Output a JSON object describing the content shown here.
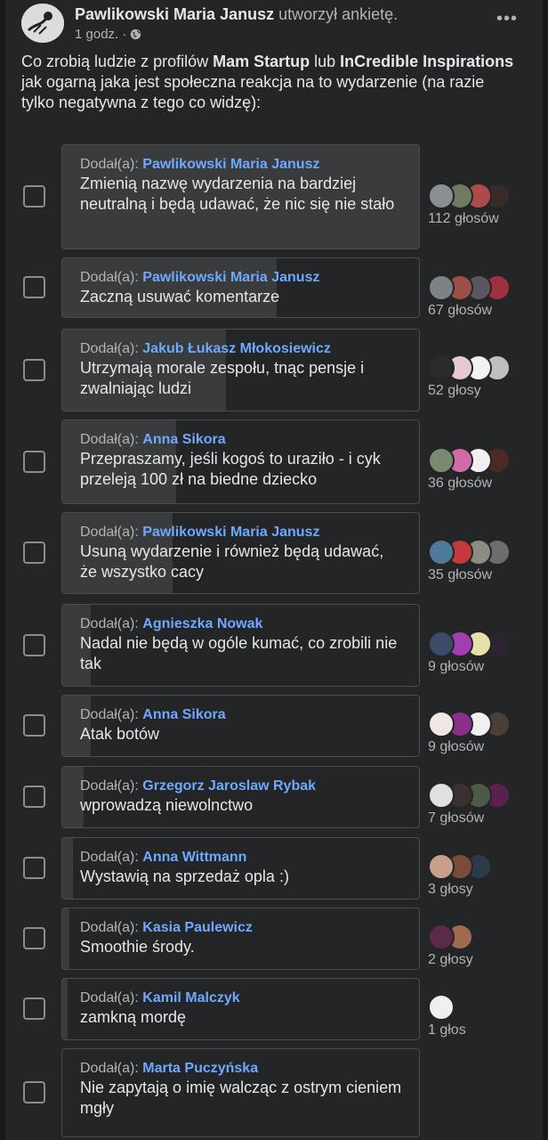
{
  "post": {
    "author": "Pawlikowski Maria Janusz",
    "action": "utworzył ankietę.",
    "time": "1 godz. ·",
    "text_parts": [
      "Co zrobią ludzie z profilów ",
      "Mam Startup",
      " lub ",
      "InCredible Inspirations",
      " jak ogarną jaka jest społeczna reakcja na to wydarzenie (na razie tylko negatywna z tego co widzę):"
    ],
    "more_label": "•••"
  },
  "added_label": "Dodał(a):",
  "options": [
    {
      "by": "Pawlikowski Maria Janusz",
      "text": "Zmienią nazwę wydarzenia na bardziej neutralną i będą udawać, że nic się nie stało",
      "votes": "112 głosów",
      "share": 1.0,
      "avatars": [
        "#8a8f94",
        "#6f7a63",
        "#b04a4a",
        "#3a2a2a"
      ]
    },
    {
      "by": "Pawlikowski Maria Janusz",
      "text": "Zaczną usuwać komentarze",
      "votes": "67 głosów",
      "share": 0.6,
      "avatars": [
        "#7d8288",
        "#9c4f47",
        "#5a5560",
        "#a03040"
      ]
    },
    {
      "by": "Jakub Łukasz Młokosiewicz",
      "text": "Utrzymają morale zespołu, tnąc pensje i zwalniając ludzi",
      "votes": "52 głosy",
      "share": 0.46,
      "avatars": [
        "#2b2b2b",
        "#e7c9d6",
        "#f2f2f2",
        "#bfbfbf"
      ]
    },
    {
      "by": "Anna Sikora",
      "text": "Przepraszamy, jeśli kogoś to uraziło - i cyk przeleją 100 zł na biedne dziecko",
      "votes": "36 głosów",
      "share": 0.32,
      "avatars": [
        "#7a8a70",
        "#d36aa8",
        "#f0f0f0",
        "#4a2a22"
      ]
    },
    {
      "by": "Pawlikowski Maria Janusz",
      "text": "Usuną wydarzenie i również będą udawać, że wszystko cacy",
      "votes": "35 głosów",
      "share": 0.31,
      "avatars": [
        "#4f7a9a",
        "#c23a3a",
        "#8c8c82",
        "#6d6d6d"
      ]
    },
    {
      "by": "Agnieszka Nowak",
      "text": "Nadal nie będą w ogóle kumać, co zrobili nie tak",
      "votes": "9 głosów",
      "share": 0.08,
      "avatars": [
        "#3e4a6a",
        "#a23fb0",
        "#e8e0a8",
        "#2d2433"
      ]
    },
    {
      "by": "Anna Sikora",
      "text": "Atak botów",
      "votes": "9 głosów",
      "share": 0.08,
      "avatars": [
        "#efe6e6",
        "#8a2f8c",
        "#f0f0f0",
        "#4a4038"
      ]
    },
    {
      "by": "Grzegorz Jaroslaw Rybak",
      "text": "wprowadzą niewolnctwo",
      "votes": "7 głosów",
      "share": 0.06,
      "avatars": [
        "#e0e0e0",
        "#3a3030",
        "#4d5a45",
        "#5a2050"
      ]
    },
    {
      "by": "Anna Wittmann",
      "text": "Wystawią na sprzedaż opla :)",
      "votes": "3 głosy",
      "share": 0.03,
      "avatars": [
        "#c7a08a",
        "#7a4a3a",
        "#2e3a4a"
      ]
    },
    {
      "by": "Kasia Paulewicz",
      "text": "Smoothie środy.",
      "votes": "2 głosy",
      "share": 0.02,
      "avatars": [
        "#5a2a4a",
        "#a06a50"
      ]
    },
    {
      "by": "Kamil Malczyk",
      "text": "zamkną mordę",
      "votes": "1 głos",
      "share": 0.01,
      "avatars": [
        "#efefef"
      ]
    },
    {
      "by": "Marta Puczyńska",
      "text": "Nie zapytają o imię walcząc z ostrym cieniem mgły",
      "votes": "",
      "share": 0.0,
      "avatars": []
    }
  ],
  "colors": {
    "link": "#6fa8ff",
    "bg": "#242526",
    "fill": "#3a3b3c"
  }
}
